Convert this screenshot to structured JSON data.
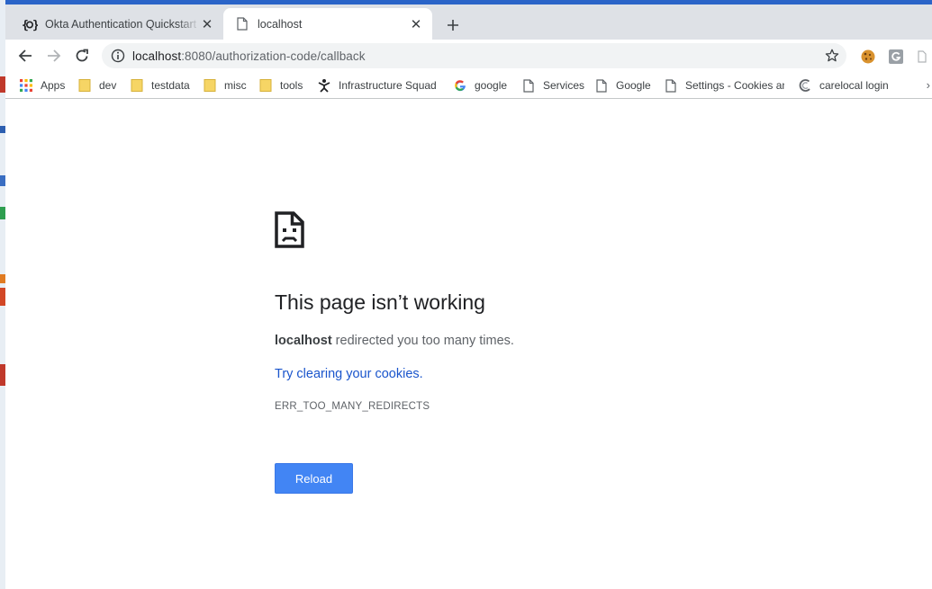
{
  "tabs": [
    {
      "title": "Okta Authentication Quickstart G",
      "icon": "okta-icon",
      "active": false
    },
    {
      "title": "localhost",
      "icon": "page-icon",
      "active": true
    }
  ],
  "toolbar": {
    "url_host": "localhost",
    "url_rest": ":8080/authorization-code/callback",
    "extensions": [
      "cookie-extension-icon",
      "grammarly-extension-icon"
    ]
  },
  "bookmarks": [
    {
      "label": "Apps",
      "icon": "apps-grid-icon"
    },
    {
      "label": "dev",
      "icon": "folder-icon"
    },
    {
      "label": "testdata",
      "icon": "folder-icon"
    },
    {
      "label": "misc",
      "icon": "folder-icon"
    },
    {
      "label": "tools",
      "icon": "folder-icon"
    },
    {
      "label": "Infrastructure Squad",
      "icon": "infrastructure-icon"
    },
    {
      "label": "google",
      "icon": "google-g-icon"
    },
    {
      "label": "Services",
      "icon": "page-icon"
    },
    {
      "label": "Google",
      "icon": "page-icon"
    },
    {
      "label": "Settings - Cookies an",
      "icon": "page-icon"
    },
    {
      "label": "carelocal login",
      "icon": "carelocal-icon"
    }
  ],
  "error": {
    "title": "This page isn’t working",
    "host": "localhost",
    "description_rest": " redirected you too many times.",
    "link": "Try clearing your cookies",
    "link_suffix": ".",
    "code": "ERR_TOO_MANY_REDIRECTS",
    "reload_label": "Reload"
  },
  "colors": {
    "accent": "#4285f4",
    "link": "#1a55cc",
    "tabstrip": "#dee1e6",
    "folder": "#f6d565"
  }
}
